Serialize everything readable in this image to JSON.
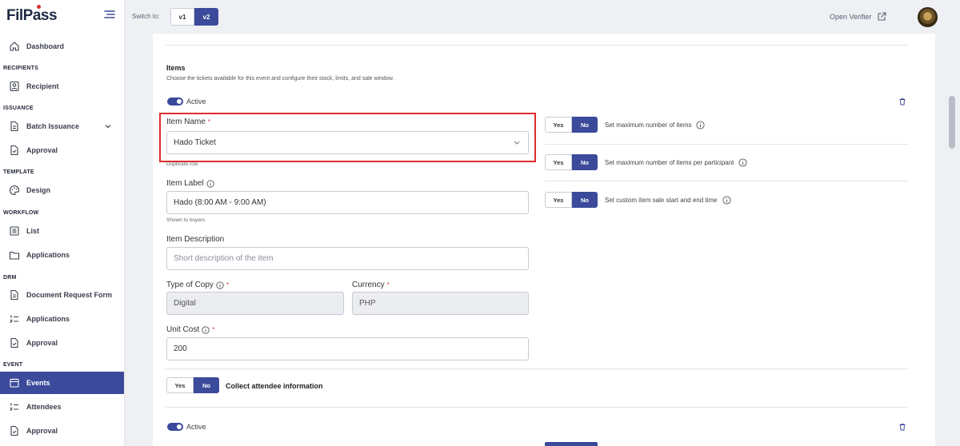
{
  "brand": {
    "name": "FilPass"
  },
  "sidebar": {
    "items": [
      {
        "label": "Dashboard"
      },
      {
        "section": "RECIPIENTS"
      },
      {
        "label": "Recipient"
      },
      {
        "section": "ISSUANCE"
      },
      {
        "label": "Batch Issuance"
      },
      {
        "label": "Approval"
      },
      {
        "section": "TEMPLATE"
      },
      {
        "label": "Design"
      },
      {
        "section": "WORKFLOW"
      },
      {
        "label": "List"
      },
      {
        "label": "Applications"
      },
      {
        "section": "DRM"
      },
      {
        "label": "Document Request Form"
      },
      {
        "label": "Applications"
      },
      {
        "label": "Approval"
      },
      {
        "section": "EVENT"
      },
      {
        "label": "Events"
      },
      {
        "label": "Attendees"
      },
      {
        "label": "Approval"
      }
    ]
  },
  "topbar": {
    "switch_label": "Switch to:",
    "v1": "v1",
    "v2": "v2",
    "open_verifier": "Open Verifier"
  },
  "items_section": {
    "title": "Items",
    "subtitle": "Choose the tickets available for this event and configure their stock, limits, and sale window.",
    "active_label": "Active",
    "active_label_2": "Active",
    "item_name_label": "Item Name",
    "item_name_value": "Hado Ticket",
    "duplicate_helper": "Duplicate row",
    "item_label_label": "Item Label",
    "item_label_value": "Hado (8:00 AM - 9:00 AM)",
    "item_label_helper": "Shown to buyers",
    "item_description_label": "Item Description",
    "item_description_placeholder": "Short description of the item",
    "type_of_copy_label": "Type of Copy",
    "type_of_copy_value": "Digital",
    "currency_label": "Currency",
    "currency_value": "PHP",
    "unit_cost_label": "Unit Cost",
    "unit_cost_value": "200",
    "yes": "Yes",
    "no": "No",
    "collect_attendee": "Collect attendee information",
    "option_max_items": "Set maximum number of items",
    "option_max_per_participant": "Set maximum number of items per participant",
    "option_custom_sale": "Set custom item sale start and end time"
  },
  "colors": {
    "accent": "#3b4a9a",
    "highlight": "#e02b2b",
    "required": "#e03131"
  }
}
